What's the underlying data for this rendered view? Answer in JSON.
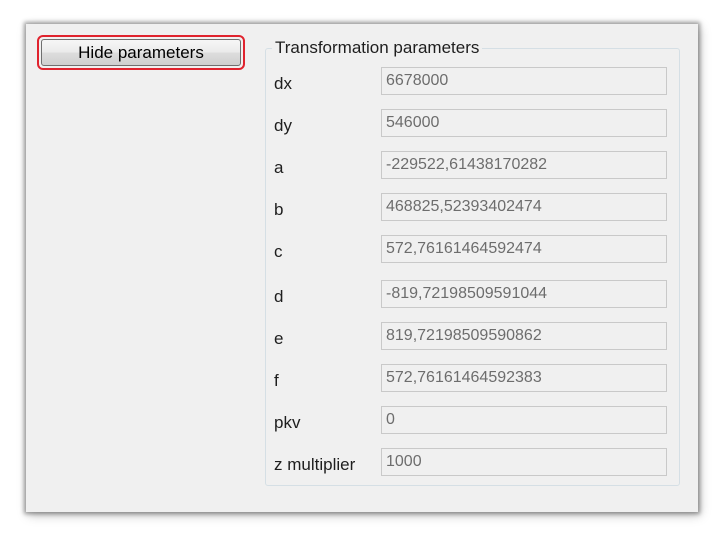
{
  "toolbar": {
    "hide_label": "Hide parameters"
  },
  "group": {
    "title": "Transformation parameters"
  },
  "params": [
    {
      "label": "dx",
      "value": "6678000"
    },
    {
      "label": "dy",
      "value": "546000"
    },
    {
      "label": "a",
      "value": "-229522,61438170282"
    },
    {
      "label": "b",
      "value": "468825,52393402474"
    },
    {
      "label": "c",
      "value": "572,76161464592474"
    },
    {
      "label": "d",
      "value": "-819,72198509591044"
    },
    {
      "label": "e",
      "value": "819,72198509590862"
    },
    {
      "label": "f",
      "value": "572,76161464592383"
    },
    {
      "label": "pkv",
      "value": "0"
    },
    {
      "label": "z multiplier",
      "value": "1000"
    }
  ],
  "colors": {
    "highlight": "#e0232e",
    "window_bg": "#f0f0f0",
    "field_text": "#6d6d6d"
  }
}
